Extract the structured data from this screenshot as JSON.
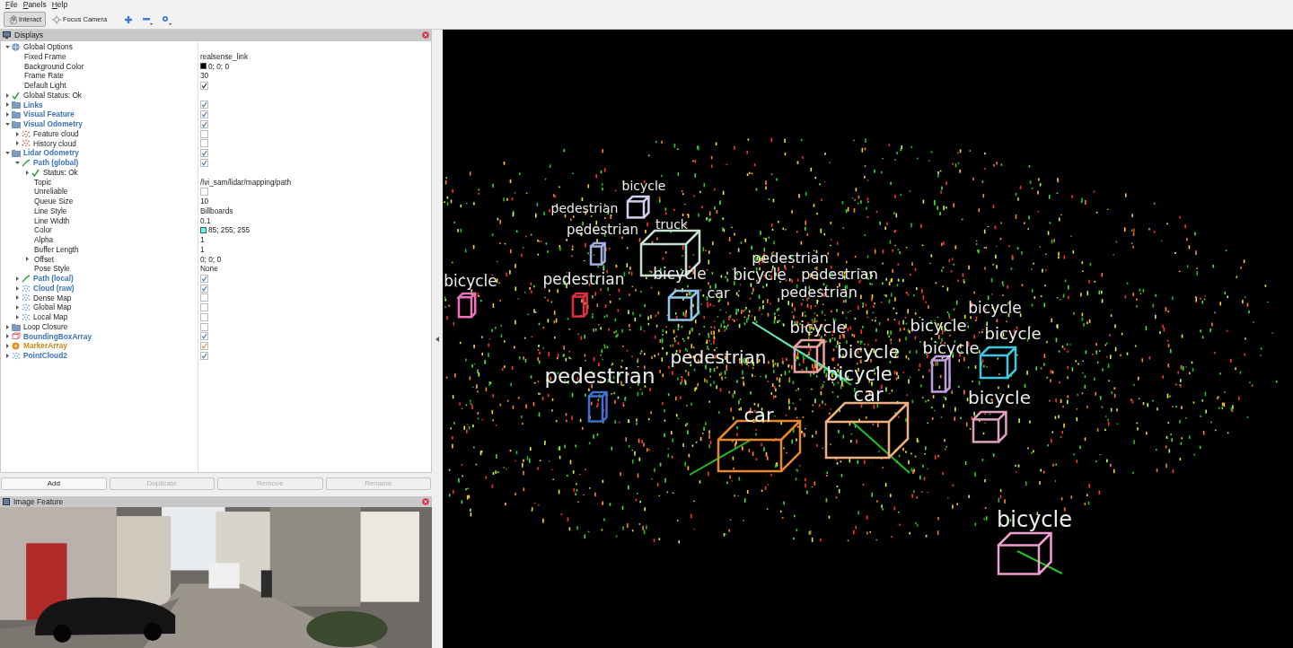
{
  "menu": [
    "File",
    "Panels",
    "Help"
  ],
  "toolbar": {
    "tools": [
      {
        "label": "Interact",
        "kind": "interact",
        "selected": true
      },
      {
        "label": "Focus Camera",
        "kind": "focus",
        "selected": false
      }
    ]
  },
  "displays_panel": {
    "title": "Displays",
    "tree": [
      {
        "label": "Global Options",
        "kind": "group",
        "expanded": true,
        "children": [
          {
            "label": "Fixed Frame",
            "kind": "property",
            "value": "realsense_link"
          },
          {
            "label": "Background Color",
            "kind": "property",
            "value": "0; 0; 0",
            "color": "#000000"
          },
          {
            "label": "Frame Rate",
            "kind": "property",
            "value": "30"
          },
          {
            "label": "Default Light",
            "kind": "property",
            "checked": true
          }
        ]
      },
      {
        "label": "Global Status: Ok",
        "kind": "status",
        "expanded": false
      },
      {
        "label": "Links",
        "kind": "folder",
        "expanded": false,
        "checked": true,
        "warning": false,
        "error": false
      },
      {
        "label": "Visual Feature",
        "kind": "folder",
        "expanded": false,
        "checked": true,
        "warning": false,
        "error": false
      },
      {
        "label": "Visual Odometry",
        "kind": "folder",
        "expanded": true,
        "checked": true,
        "warning": false,
        "error": false,
        "children": [
          {
            "label": "Feature cloud",
            "kind": "cloud",
            "expanded": false,
            "checked": false,
            "warning": false,
            "error": true
          },
          {
            "label": "History cloud",
            "kind": "cloud",
            "expanded": false,
            "checked": false,
            "warning": false,
            "error": true
          }
        ]
      },
      {
        "label": "Lidar Odometry",
        "kind": "folder",
        "expanded": true,
        "checked": true,
        "warning": false,
        "error": false,
        "children": [
          {
            "label": "Path (global)",
            "kind": "path",
            "expanded": true,
            "checked": true,
            "warning": false,
            "error": false,
            "children": [
              {
                "label": "Status: Ok",
                "kind": "status",
                "expanded": false
              },
              {
                "label": "Topic",
                "kind": "property",
                "value": "/lvi_sam/lidar/mapping/path"
              },
              {
                "label": "Unreliable",
                "kind": "property",
                "checked": false
              },
              {
                "label": "Queue Size",
                "kind": "property",
                "value": "10"
              },
              {
                "label": "Line Style",
                "kind": "property",
                "value": "Billboards"
              },
              {
                "label": "Line Width",
                "kind": "property",
                "value": "0.1"
              },
              {
                "label": "Color",
                "kind": "property",
                "value": "85; 255; 255",
                "color": "#55ffff"
              },
              {
                "label": "Alpha",
                "kind": "property",
                "value": "1"
              },
              {
                "label": "Buffer Length",
                "kind": "property",
                "value": "1"
              },
              {
                "label": "Offset",
                "kind": "property",
                "value": "0; 0; 0",
                "expanded": false
              },
              {
                "label": "Pose Style",
                "kind": "property",
                "value": "None"
              }
            ]
          },
          {
            "label": "Path (local)",
            "kind": "path",
            "expanded": false,
            "checked": true,
            "warning": false,
            "error": false
          },
          {
            "label": "Cloud (raw)",
            "kind": "cloud",
            "expanded": false,
            "checked": true,
            "warning": false,
            "error": false
          },
          {
            "label": "Dense Map",
            "kind": "cloud",
            "expanded": false,
            "checked": false,
            "warning": false,
            "error": false
          },
          {
            "label": "Global Map",
            "kind": "cloud",
            "expanded": false,
            "checked": false,
            "warning": false,
            "error": false
          },
          {
            "label": "Local Map",
            "kind": "cloud",
            "expanded": false,
            "checked": false,
            "warning": false,
            "error": false
          }
        ]
      },
      {
        "label": "Loop Closure",
        "kind": "folder",
        "expanded": false,
        "checked": false,
        "warning": false,
        "error": false
      },
      {
        "label": "BoundingBoxArray",
        "kind": "bbox",
        "expanded": false,
        "checked": true,
        "warning": false,
        "error": false
      },
      {
        "label": "MarkerArray",
        "kind": "marker",
        "expanded": false,
        "checked": true,
        "warning": true,
        "error": false
      },
      {
        "label": "PointCloud2",
        "kind": "cloud",
        "expanded": false,
        "checked": true,
        "warning": false,
        "error": false
      }
    ],
    "buttons": [
      {
        "label": "Add",
        "disabled": false
      },
      {
        "label": "Duplicate",
        "disabled": true
      },
      {
        "label": "Remove",
        "disabled": true
      },
      {
        "label": "Rename",
        "disabled": true
      }
    ]
  },
  "image_panel": {
    "title": "Image Feature"
  },
  "viewport": {
    "labels": [
      {
        "text": "bicycle"
      },
      {
        "text": "pedestrian"
      },
      {
        "text": "truck"
      },
      {
        "text": "pedestrian"
      },
      {
        "text": "bicycle"
      },
      {
        "text": "pedestrian"
      },
      {
        "text": "bicycle"
      },
      {
        "text": "car"
      },
      {
        "text": "pedestrian"
      },
      {
        "text": "bicycle"
      },
      {
        "text": "pedestrian"
      },
      {
        "text": "pedestrian"
      },
      {
        "text": "bicycle"
      },
      {
        "text": "bicycle"
      },
      {
        "text": "bicycle"
      },
      {
        "text": "bicycle"
      },
      {
        "text": "bicycle"
      },
      {
        "text": "pedestrian"
      },
      {
        "text": "bicycle"
      },
      {
        "text": "pedestrian"
      },
      {
        "text": "bicycle"
      },
      {
        "text": "car"
      },
      {
        "text": "bicycle"
      },
      {
        "text": "car"
      },
      {
        "text": "bicycle"
      }
    ]
  }
}
